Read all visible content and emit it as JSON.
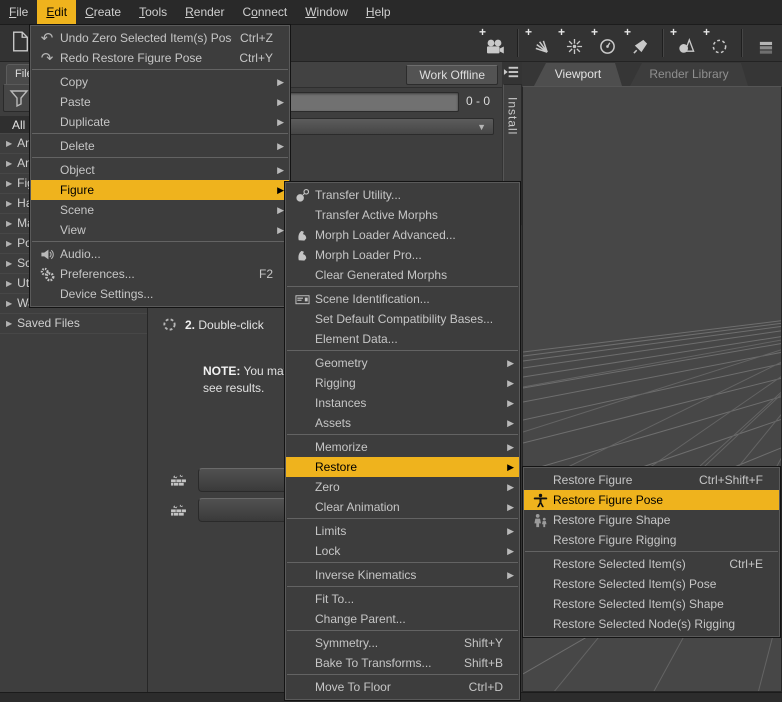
{
  "colors": {
    "highlight": "#efb31d",
    "menu_bg": "#3d3d3d",
    "viewport_bg": "#474747",
    "menubar_bg": "#292929"
  },
  "menubar": {
    "items": [
      {
        "label": "File",
        "underline": 0
      },
      {
        "label": "Edit",
        "underline": 0,
        "active": true
      },
      {
        "label": "Create",
        "underline": 0
      },
      {
        "label": "Tools",
        "underline": 0
      },
      {
        "label": "Render",
        "underline": 0
      },
      {
        "label": "Connect",
        "underline": 1
      },
      {
        "label": "Window",
        "underline": 0
      },
      {
        "label": "Help",
        "underline": 0
      }
    ]
  },
  "toolbar": {
    "left_icons": [
      "new-document"
    ],
    "groups": [
      [
        "new-camera"
      ],
      [
        "new-distant-light",
        "new-point-light",
        "new-gauge-light",
        "new-spotlight"
      ],
      [
        "new-primitive",
        "new-null"
      ],
      [
        "pane-list"
      ]
    ]
  },
  "left_panel": {
    "tab_label": "Files",
    "all_label": "All",
    "rows": [
      "Anatomy",
      "Animals",
      "Figures",
      "Hair",
      "Materials",
      "Poses",
      "Scenes",
      "Utilities",
      "Wardrobe",
      "Saved Files"
    ]
  },
  "content_panel": {
    "work_offline": "Work Offline",
    "range": "0 - 0",
    "install_tab": "Install",
    "step2_num": "2.",
    "step2_text": "Double-click",
    "note_bold": "NOTE:",
    "note_line1": " You may",
    "note_line2": "see results."
  },
  "viewport": {
    "tabs": [
      {
        "label": "Viewport",
        "active": true
      },
      {
        "label": "Render Library",
        "active": false
      }
    ]
  },
  "menus": {
    "edit": {
      "items": [
        {
          "label": "Undo Zero Selected Item(s) Pose",
          "shortcut": "Ctrl+Z",
          "icon": "undo"
        },
        {
          "label": "Redo Restore Figure Pose",
          "shortcut": "Ctrl+Y",
          "icon": "redo"
        },
        {
          "sep": true
        },
        {
          "label": "Copy",
          "submenu": true
        },
        {
          "label": "Paste",
          "submenu": true
        },
        {
          "label": "Duplicate",
          "submenu": true
        },
        {
          "sep": true
        },
        {
          "label": "Delete",
          "submenu": true
        },
        {
          "sep": true
        },
        {
          "label": "Object",
          "submenu": true
        },
        {
          "label": "Figure",
          "submenu": true,
          "highlighted": true
        },
        {
          "label": "Scene",
          "submenu": true
        },
        {
          "label": "View",
          "submenu": true
        },
        {
          "sep": true
        },
        {
          "label": "Audio...",
          "icon": "audio"
        },
        {
          "label": "Preferences...",
          "shortcut": "F2",
          "icon": "gears"
        },
        {
          "label": "Device Settings..."
        }
      ]
    },
    "figure": {
      "items": [
        {
          "label": "Transfer Utility...",
          "icon": "transfer"
        },
        {
          "label": "Transfer Active Morphs"
        },
        {
          "label": "Morph Loader Advanced...",
          "icon": "morph"
        },
        {
          "label": "Morph Loader Pro...",
          "icon": "morph"
        },
        {
          "label": "Clear Generated Morphs"
        },
        {
          "sep": true
        },
        {
          "label": "Scene Identification...",
          "icon": "id-card"
        },
        {
          "label": "Set Default Compatibility Bases..."
        },
        {
          "label": "Element Data..."
        },
        {
          "sep": true
        },
        {
          "label": "Geometry",
          "submenu": true
        },
        {
          "label": "Rigging",
          "submenu": true
        },
        {
          "label": "Instances",
          "submenu": true
        },
        {
          "label": "Assets",
          "submenu": true
        },
        {
          "sep": true
        },
        {
          "label": "Memorize",
          "submenu": true
        },
        {
          "label": "Restore",
          "submenu": true,
          "highlighted": true
        },
        {
          "label": "Zero",
          "submenu": true
        },
        {
          "label": "Clear Animation",
          "submenu": true
        },
        {
          "sep": true
        },
        {
          "label": "Limits",
          "submenu": true
        },
        {
          "label": "Lock",
          "submenu": true
        },
        {
          "sep": true
        },
        {
          "label": "Inverse Kinematics",
          "submenu": true
        },
        {
          "sep": true
        },
        {
          "label": "Fit To..."
        },
        {
          "label": "Change Parent..."
        },
        {
          "sep": true
        },
        {
          "label": "Symmetry...",
          "shortcut": "Shift+Y"
        },
        {
          "label": "Bake To Transforms...",
          "shortcut": "Shift+B"
        },
        {
          "sep": true
        },
        {
          "label": "Move To Floor",
          "shortcut": "Ctrl+D"
        }
      ]
    },
    "restore": {
      "items": [
        {
          "label": "Restore Figure",
          "shortcut": "Ctrl+Shift+F"
        },
        {
          "label": "Restore Figure Pose",
          "icon": "pose-figure",
          "highlighted": true
        },
        {
          "label": "Restore Figure Shape",
          "icon": "shape-figures"
        },
        {
          "label": "Restore Figure Rigging"
        },
        {
          "sep": true
        },
        {
          "label": "Restore Selected Item(s)",
          "shortcut": "Ctrl+E"
        },
        {
          "label": "Restore Selected Item(s) Pose"
        },
        {
          "label": "Restore Selected Item(s) Shape"
        },
        {
          "label": "Restore Selected Node(s) Rigging"
        }
      ]
    }
  }
}
